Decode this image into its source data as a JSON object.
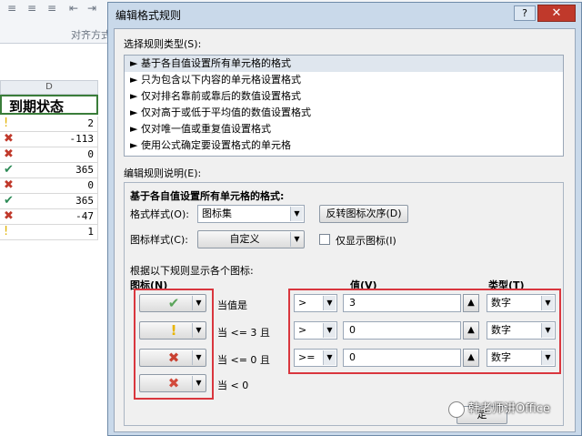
{
  "excel": {
    "ribbon_group": "对齐方式",
    "column_letter": "D",
    "header": "到期状态",
    "rows": [
      {
        "icon": "!",
        "icon_name": "exclamation-icon",
        "color": "#e0b100",
        "value": "2"
      },
      {
        "icon": "✖",
        "icon_name": "red-cross-icon",
        "color": "#c0392b",
        "value": "-113"
      },
      {
        "icon": "✖",
        "icon_name": "red-circle-cross-icon",
        "color": "#c0392b",
        "value": "0"
      },
      {
        "icon": "✔",
        "icon_name": "green-check-icon",
        "color": "#2e8b57",
        "value": "365"
      },
      {
        "icon": "✖",
        "icon_name": "red-circle-cross-icon",
        "color": "#c0392b",
        "value": "0"
      },
      {
        "icon": "✔",
        "icon_name": "green-check-icon",
        "color": "#2e8b57",
        "value": "365"
      },
      {
        "icon": "✖",
        "icon_name": "red-cross-icon",
        "color": "#c0392b",
        "value": "-47"
      },
      {
        "icon": "!",
        "icon_name": "exclamation-icon",
        "color": "#e0b100",
        "value": "1"
      }
    ]
  },
  "dialog": {
    "title": "编辑格式规则",
    "help_label": "?",
    "close_label": "✕",
    "select_rule_type_label": "选择规则类型(S):",
    "rule_types": [
      "► 基于各自值设置所有单元格的格式",
      "► 只为包含以下内容的单元格设置格式",
      "► 仅对排名靠前或靠后的数值设置格式",
      "► 仅对高于或低于平均值的数值设置格式",
      "► 仅对唯一值或重复值设置格式",
      "► 使用公式确定要设置格式的单元格"
    ],
    "edit_desc_label": "编辑规则说明(E):",
    "format_all_label": "基于各自值设置所有单元格的格式:",
    "format_style_label": "格式样式(O):",
    "format_style_value": "图标集",
    "reverse_btn": "反转图标次序(D)",
    "icon_style_label": "图标样式(C):",
    "icon_style_value": "自定义",
    "show_icon_only": "仅显示图标(I)",
    "rules_display_label": "根据以下规则显示各个图标:",
    "col_icon": "图标(N)",
    "col_value": "值(V)",
    "col_type": "类型(T)",
    "icon_rules": [
      {
        "glyph": "✔",
        "color": "#5aa45a",
        "condition": "当值是",
        "op": ">",
        "value": "3",
        "type": "数字"
      },
      {
        "glyph": "!",
        "color": "#e8b400",
        "condition": "当 <= 3 且",
        "op": ">",
        "value": "0",
        "type": "数字"
      },
      {
        "glyph": "✖",
        "color": "#c94030",
        "condition": "当 <= 0 且",
        "op": ">=",
        "value": "0",
        "type": "数字"
      },
      {
        "glyph": "✖",
        "color": "#d24a3c",
        "condition": "当 < 0",
        "op": "",
        "value": "",
        "type": ""
      }
    ],
    "ok_btn_partial": "定",
    "watermark": "韩老师讲Office"
  }
}
